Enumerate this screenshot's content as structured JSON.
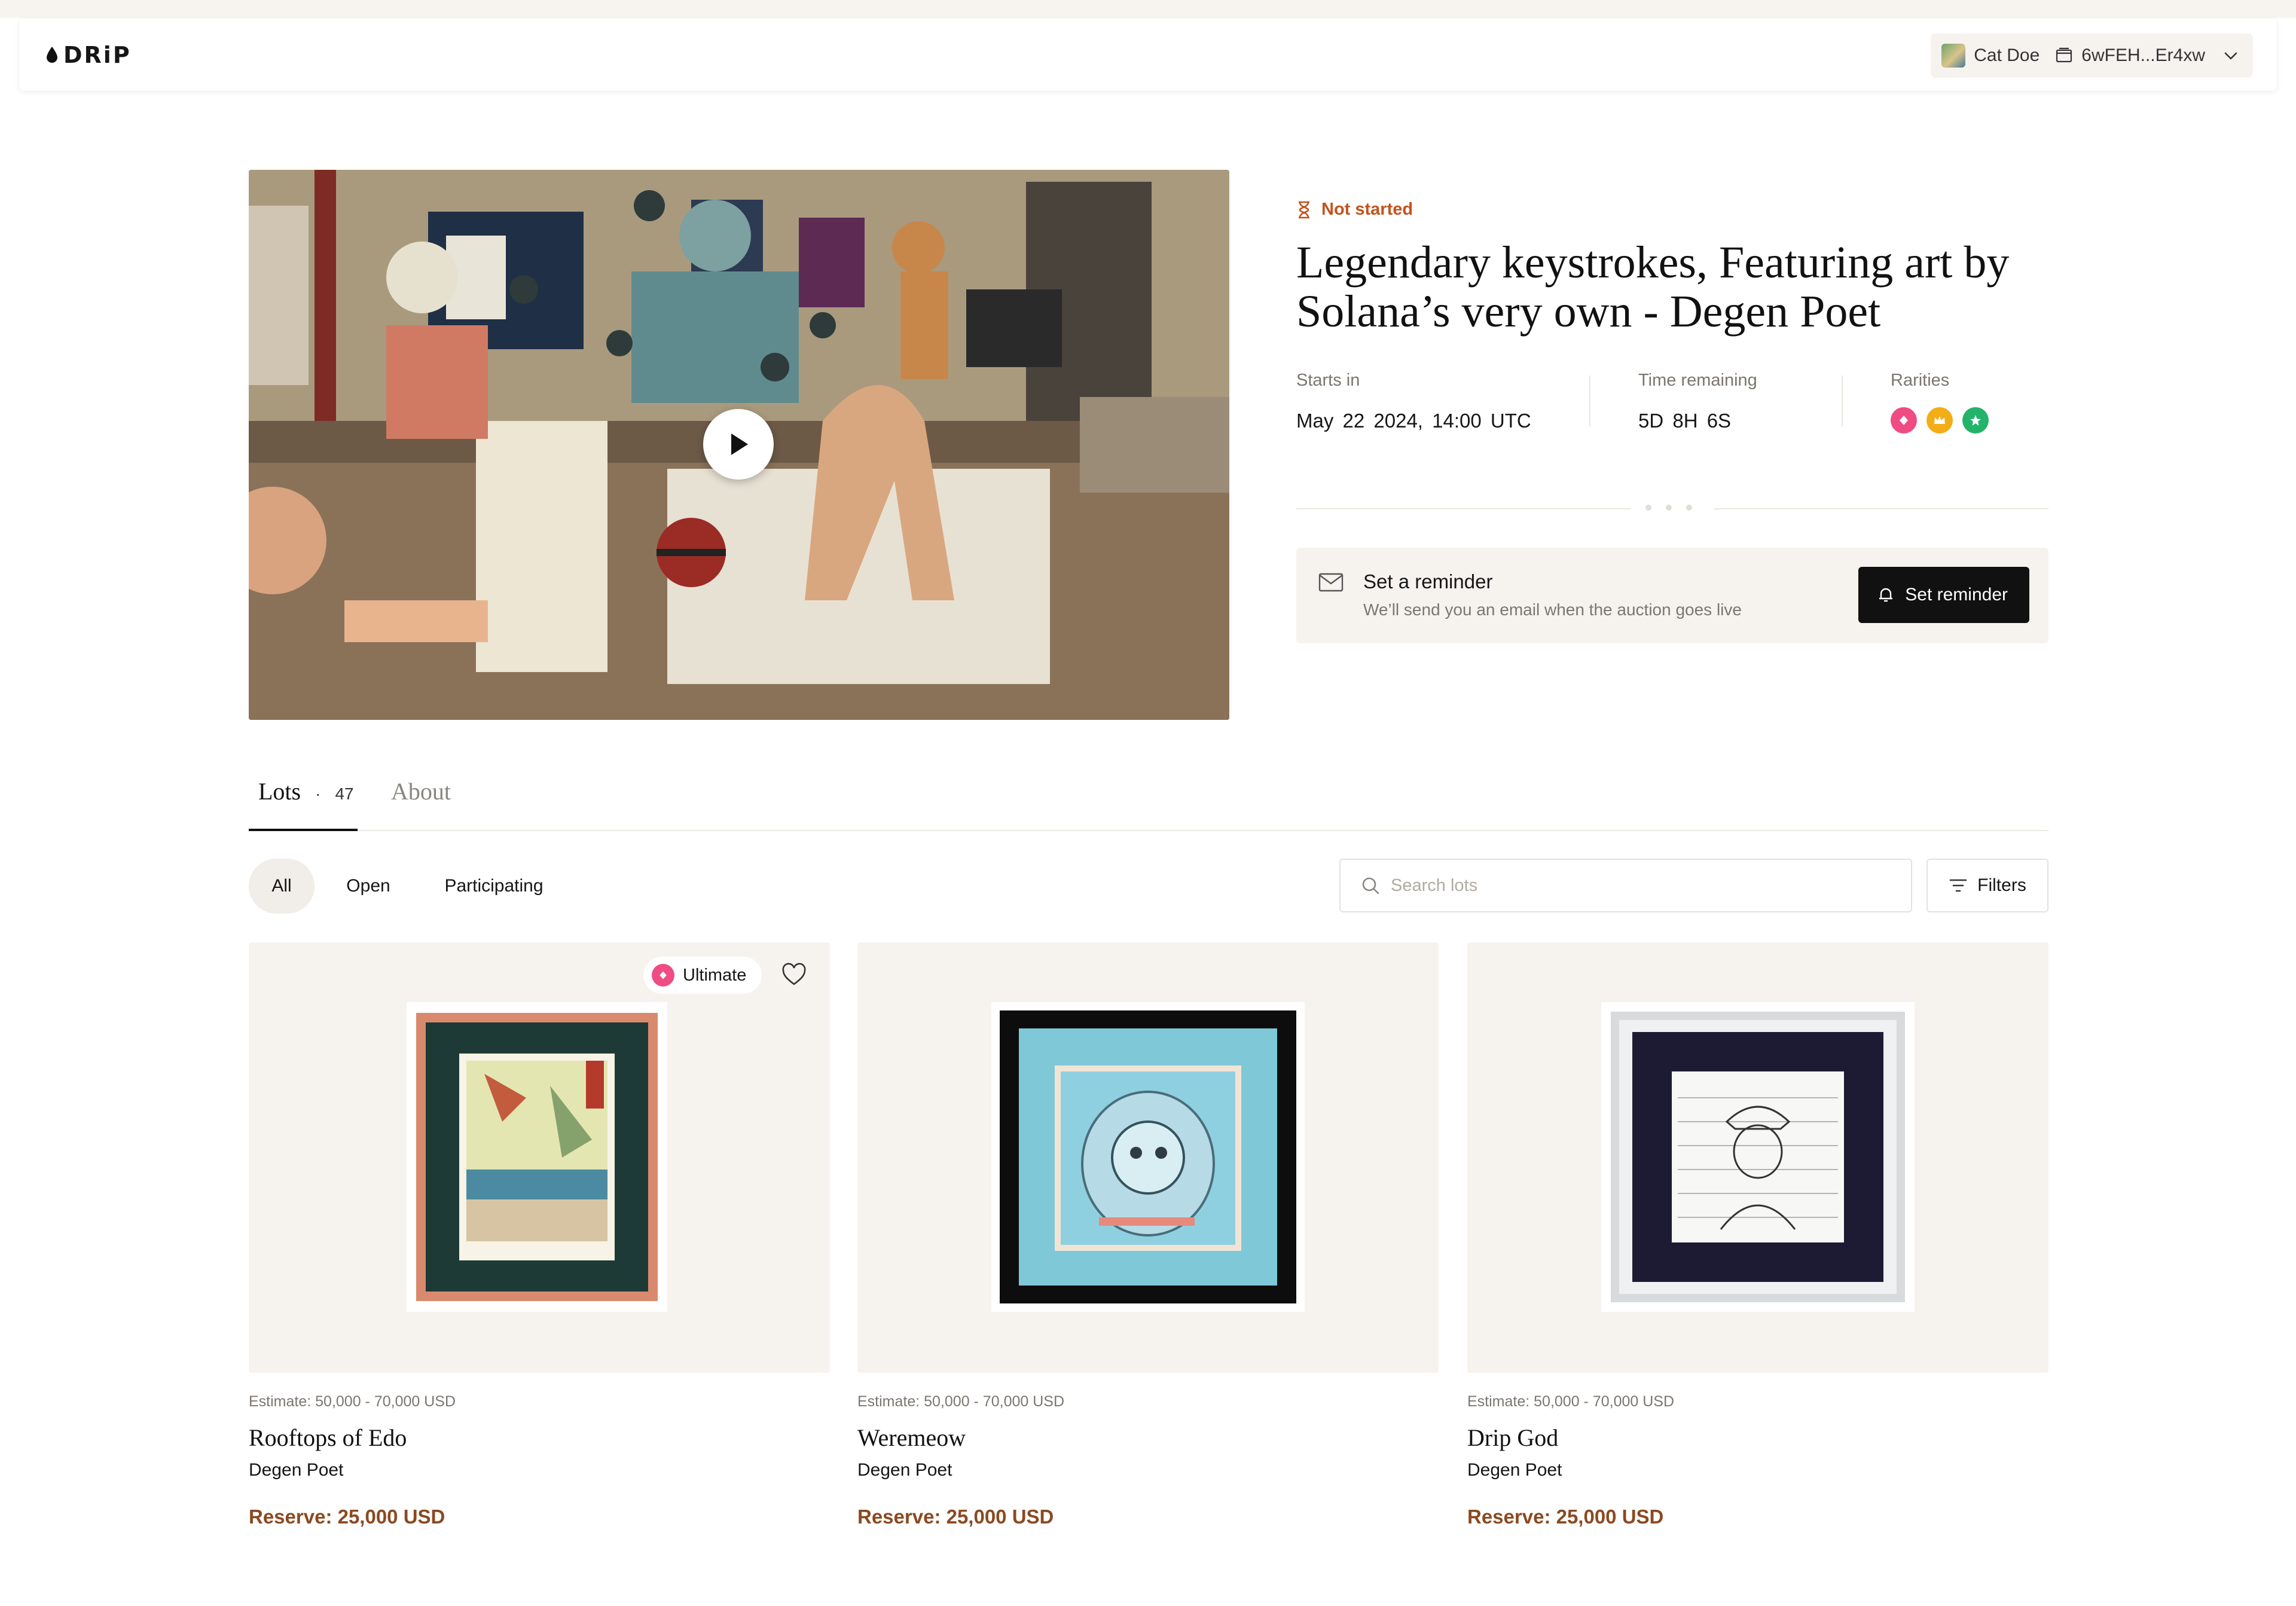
{
  "nav": {
    "logo": "DRiP",
    "user_name": "Cat Doe",
    "wallet": "6wFEH...Er4xw"
  },
  "auction": {
    "status": "Not started",
    "title": "Legendary keystrokes, Featuring art by Solana’s very own - Degen Poet",
    "starts_label": "Starts in",
    "starts_value": "May 22 2024, 14:00 UTC",
    "remaining_label": "Time remaining",
    "remaining_value": "5D 8H 6S",
    "rarities_label": "Rarities",
    "rarities": [
      {
        "name": "ultimate",
        "color": "#ef4c84",
        "icon": "diamond-icon"
      },
      {
        "name": "legendary",
        "color": "#f3ad16",
        "icon": "crown-icon"
      },
      {
        "name": "rare",
        "color": "#24b36b",
        "icon": "star-icon"
      }
    ]
  },
  "reminder": {
    "title": "Set a reminder",
    "subtitle": "We’ll send you an email when the auction goes live",
    "button": "Set reminder"
  },
  "tabs": {
    "lots_label": "Lots",
    "separator": "·",
    "lots_count": "47",
    "about_label": "About"
  },
  "filters": {
    "chips": [
      "All",
      "Open",
      "Participating"
    ],
    "active": "All",
    "search_placeholder": "Search lots",
    "filters_button": "Filters"
  },
  "lots": [
    {
      "estimate": "Estimate: 50,000 - 70,000 USD",
      "title": "Rooftops of Edo",
      "artist": "Degen Poet",
      "reserve": "Reserve: 25,000 USD",
      "badge": "Ultimate"
    },
    {
      "estimate": "Estimate: 50,000 - 70,000 USD",
      "title": "Weremeow",
      "artist": "Degen Poet",
      "reserve": "Reserve: 25,000 USD"
    },
    {
      "estimate": "Estimate: 50,000 - 70,000 USD",
      "title": "Drip God",
      "artist": "Degen Poet",
      "reserve": "Reserve: 25,000 USD"
    }
  ],
  "colors": {
    "accent_status": "#c4531b",
    "reserve": "#8b4a21",
    "button_bg": "#111111",
    "surface": "#f6f3ef"
  }
}
